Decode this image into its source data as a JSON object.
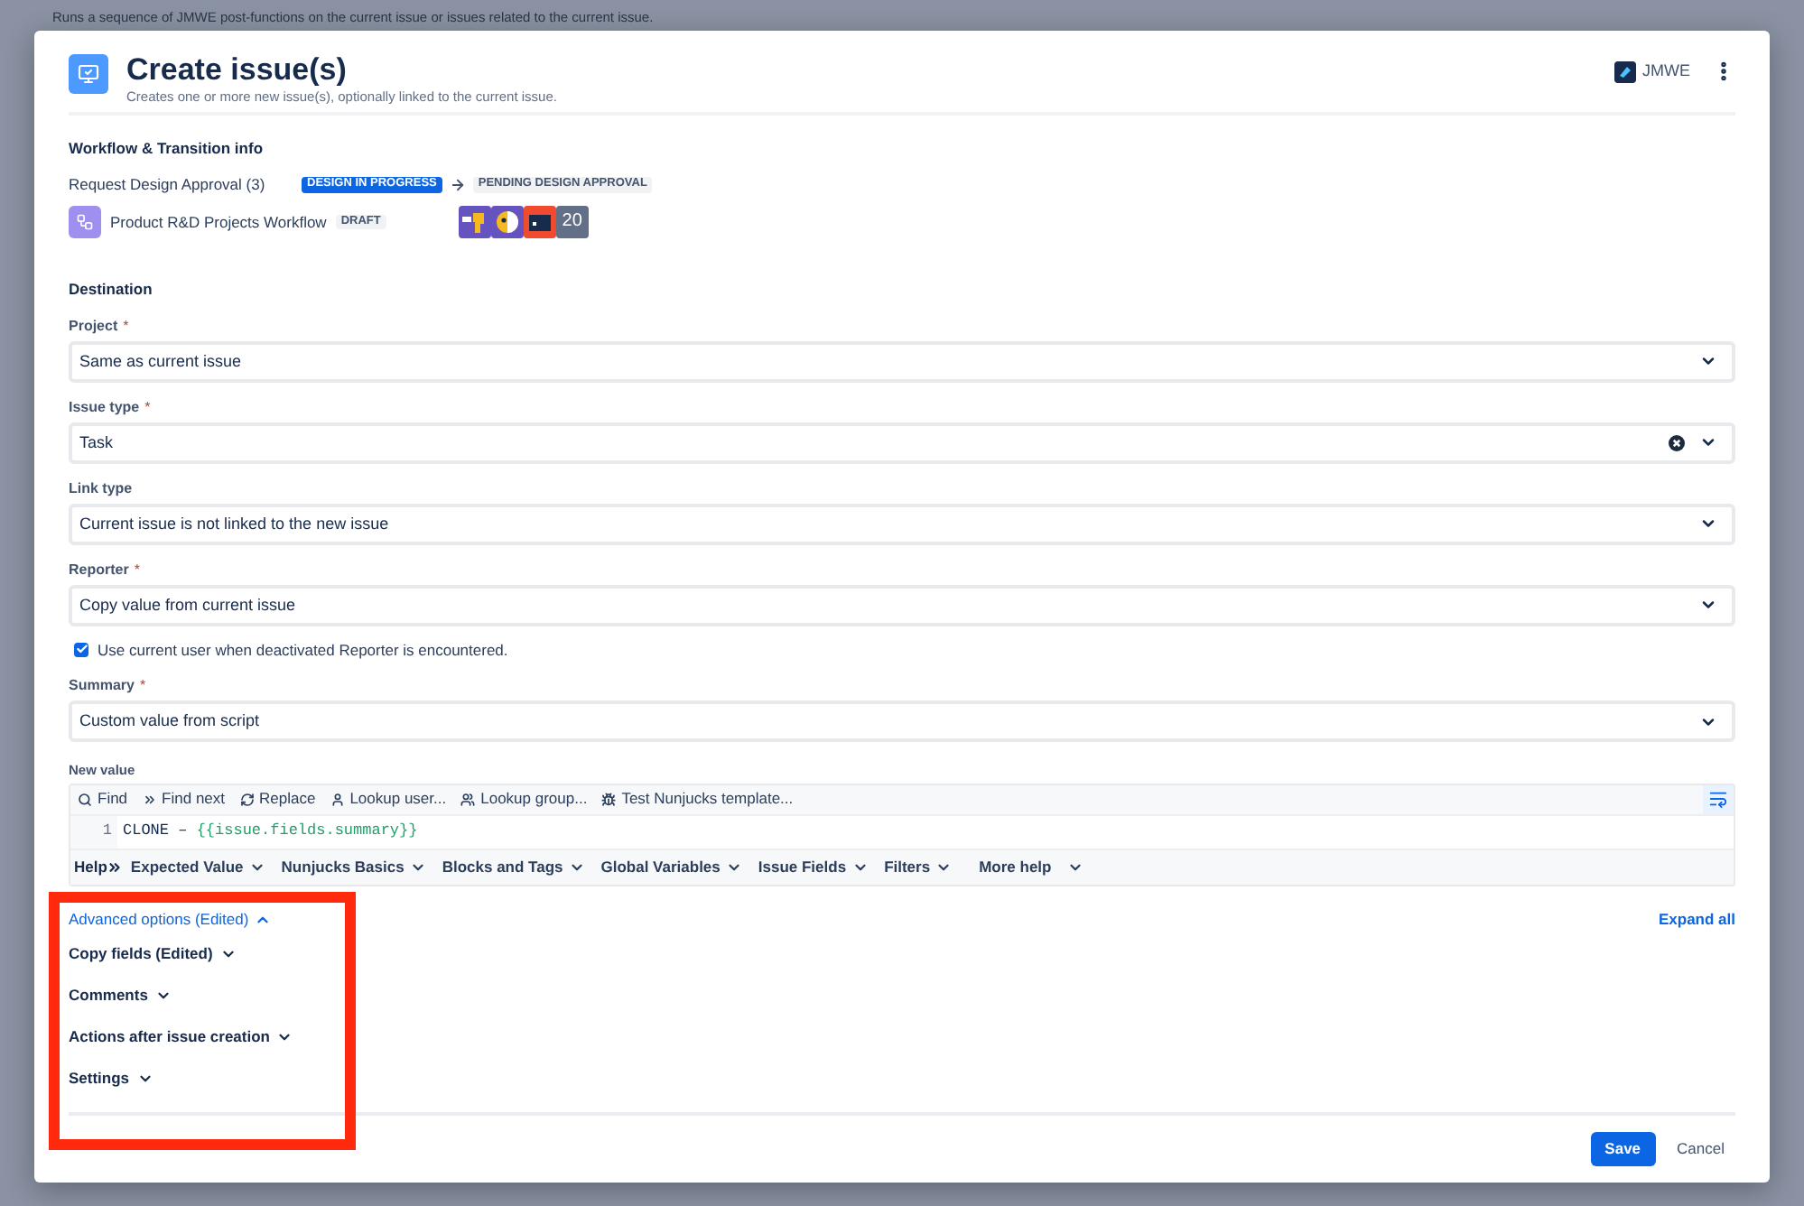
{
  "background": {
    "subtitle": "Runs a sequence of JMWE post-functions on the current issue or issues related to the current issue."
  },
  "dialog": {
    "title": "Create issue(s)",
    "subtitle": "Creates one or more new issue(s), optionally linked to the current issue.",
    "app_badge": "JMWE"
  },
  "workflow_section": {
    "heading": "Workflow & Transition info",
    "transition": "Request Design Approval (3)",
    "from_status": "DESIGN IN PROGRESS",
    "to_status": "PENDING DESIGN APPROVAL",
    "workflow": "Product R&D Projects Workflow",
    "workflow_state": "DRAFT",
    "app_count": "20"
  },
  "destination": {
    "heading": "Destination",
    "fields": [
      {
        "kind": "select",
        "label": "Project",
        "required_mark": "*",
        "value": "Same as current issue"
      },
      {
        "kind": "select",
        "label": "Issue type",
        "required_mark": "*",
        "value": "Task",
        "clearable": true
      },
      {
        "kind": "select",
        "label": "Link type",
        "value": "Current issue is not linked to the new issue"
      },
      {
        "kind": "select",
        "label": "Reporter",
        "required_mark": "*",
        "value": "Copy value from current issue"
      },
      {
        "kind": "checkbox",
        "label": "Use current user when deactivated Reporter is encountered.",
        "checked": true
      },
      {
        "kind": "select",
        "label": "Summary",
        "required_mark": "*",
        "value": "Custom value from script"
      }
    ]
  },
  "editor": {
    "label": "New value",
    "toolbar": [
      {
        "label": "Find"
      },
      {
        "label": "Find next"
      },
      {
        "label": "Replace"
      },
      {
        "label": "Lookup user..."
      },
      {
        "label": "Lookup group..."
      },
      {
        "label": "Test Nunjucks template..."
      }
    ],
    "lines": [
      {
        "number": "1",
        "text": "CLONE – ",
        "template": "{{issue.fields.summary}}"
      }
    ],
    "help_label": "Help",
    "help_menus": [
      "Expected Value",
      "Nunjucks Basics",
      "Blocks and Tags",
      "Global Variables",
      "Issue Fields",
      "Filters",
      "More help"
    ]
  },
  "advanced": {
    "toggle": "Advanced options (Edited)",
    "expanded": true,
    "expand_all": "Expand all",
    "sections": [
      {
        "label": "Copy fields (Edited)",
        "expanded": false
      },
      {
        "label": "Comments",
        "expanded": false
      },
      {
        "label": "Actions after issue creation",
        "expanded": false
      },
      {
        "label": "Settings",
        "expanded": false
      }
    ]
  },
  "footer": {
    "buttons": [
      {
        "label": "Save",
        "kind": "primary"
      },
      {
        "label": "Cancel",
        "kind": "subtle"
      }
    ]
  }
}
